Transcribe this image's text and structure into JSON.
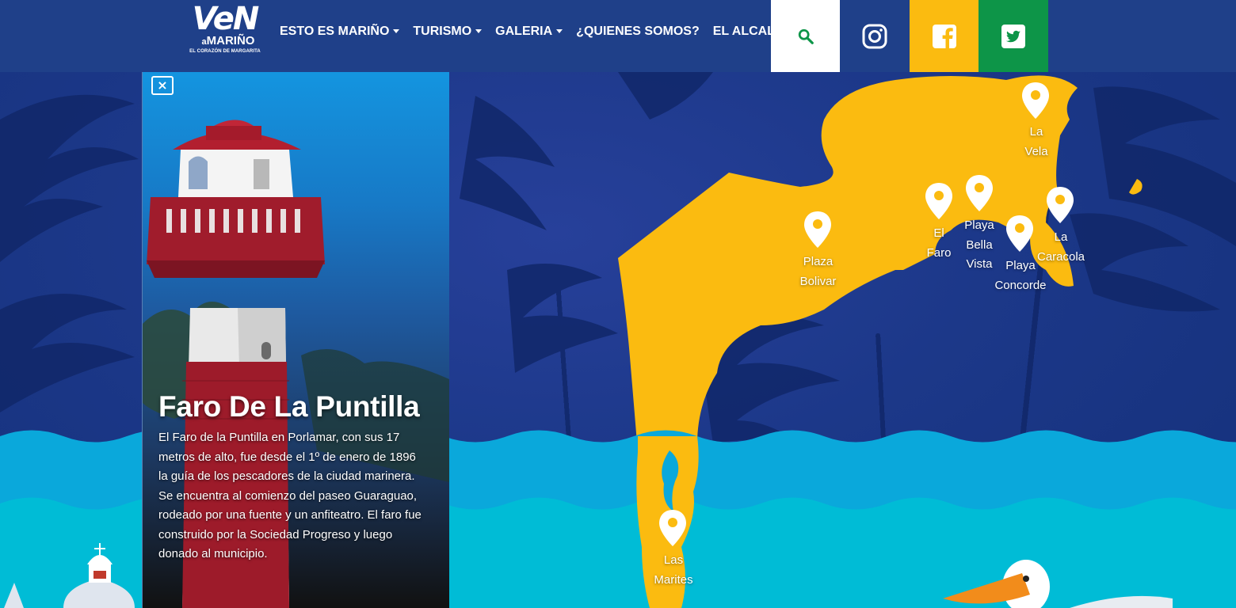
{
  "brand": {
    "logo_big": "VeN",
    "logo_a": "a",
    "logo_mid": "MARIÑO",
    "logo_small": "EL CORAZÓN DE MARGARITA"
  },
  "nav": {
    "items": [
      {
        "label": "ESTO ES MARIÑO",
        "dropdown": true
      },
      {
        "label": "TURISMO",
        "dropdown": true
      },
      {
        "label": "GALERIA",
        "dropdown": true
      },
      {
        "label": "¿QUIENES SOMOS?",
        "dropdown": false
      },
      {
        "label": "EL ALCALDE",
        "dropdown": false
      }
    ],
    "search_icon": "search-icon",
    "social": [
      {
        "name": "instagram-icon",
        "color": "#1f4089"
      },
      {
        "name": "facebook-icon",
        "color": "#fbbb10"
      },
      {
        "name": "twitter-icon",
        "color": "#0d9548"
      }
    ]
  },
  "card": {
    "close_label": "×",
    "title": "Faro De La Puntilla",
    "description": "El Faro de la Puntilla en Porlamar, con sus 17 metros de alto, fue desde el 1º de enero de 1896 la guía de los pescadores de la ciudad marinera. Se encuentra al comienzo del paseo Guaraguao, rodeado por una fuente y un anfiteatro. El faro fue construido por la Sociedad Progreso y luego donado al municipio."
  },
  "map": {
    "pins": [
      {
        "id": "la-vela",
        "line1": "La",
        "line2": "Vela"
      },
      {
        "id": "plaza-bolivar",
        "line1": "Plaza",
        "line2": "Bolivar"
      },
      {
        "id": "el-faro",
        "line1": "El",
        "line2": "Faro"
      },
      {
        "id": "playa-bella-vista",
        "line1": "Playa",
        "line2": "Bella",
        "line3": "Vista"
      },
      {
        "id": "playa-concorde",
        "line1": "Playa",
        "line2": "Concorde"
      },
      {
        "id": "la-caracola",
        "line1": "La",
        "line2": "Caracola"
      },
      {
        "id": "las-marites",
        "line1": "Las",
        "line2": "Marites"
      }
    ]
  },
  "colors": {
    "navy": "#1f4089",
    "yellow": "#fbbb10",
    "green": "#0d9548",
    "sea": "#00b6d6"
  }
}
